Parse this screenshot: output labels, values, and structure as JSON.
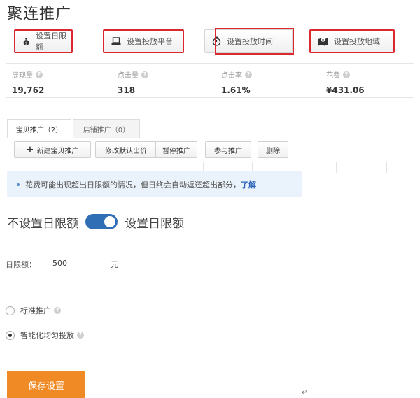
{
  "page": {
    "title": "聚连推广"
  },
  "settings_buttons": [
    {
      "label": "设置日限额",
      "icon": "money-bag-icon"
    },
    {
      "label": "设置投放平台",
      "icon": "laptop-icon"
    },
    {
      "label": "设置投放时间",
      "icon": "timer-icon"
    },
    {
      "label": "设置投放地域",
      "icon": "map-pin-icon"
    }
  ],
  "metrics": [
    {
      "label": "展现量",
      "value": "19,762"
    },
    {
      "label": "点击量",
      "value": "318"
    },
    {
      "label": "点击率",
      "value": "1.61%"
    },
    {
      "label": "花费",
      "value": "¥431.06"
    }
  ],
  "tabs": [
    {
      "label": "宝贝推广（2）",
      "active": true
    },
    {
      "label": "店铺推广（0）",
      "active": false
    }
  ],
  "toolbar": {
    "new_item": "新建宝贝推广",
    "modify_bid": "修改默认出价",
    "pause": "暂停推广",
    "join": "参与推广",
    "delete": "删除"
  },
  "notice": {
    "text": "花费可能出现超出日限额的情况，但日终会自动返还超出部分，",
    "link": "了解"
  },
  "budget_toggle": {
    "off_label": "不设置日限额",
    "on_label": "设置日限额",
    "on": true
  },
  "budget": {
    "label": "日限额：",
    "value": "500",
    "unit": "元"
  },
  "delivery_mode": {
    "standard": "标准推广",
    "smart": "智能化均匀投放",
    "selected": "smart"
  },
  "save_button": "保存设置",
  "cursor_mark": "↵",
  "colors": {
    "highlight_border": "#d9282f",
    "toggle_on": "#2f6db5",
    "save_button": "#f08a24",
    "link": "#2b62b8",
    "notice_bg": "#eaf3fb"
  }
}
